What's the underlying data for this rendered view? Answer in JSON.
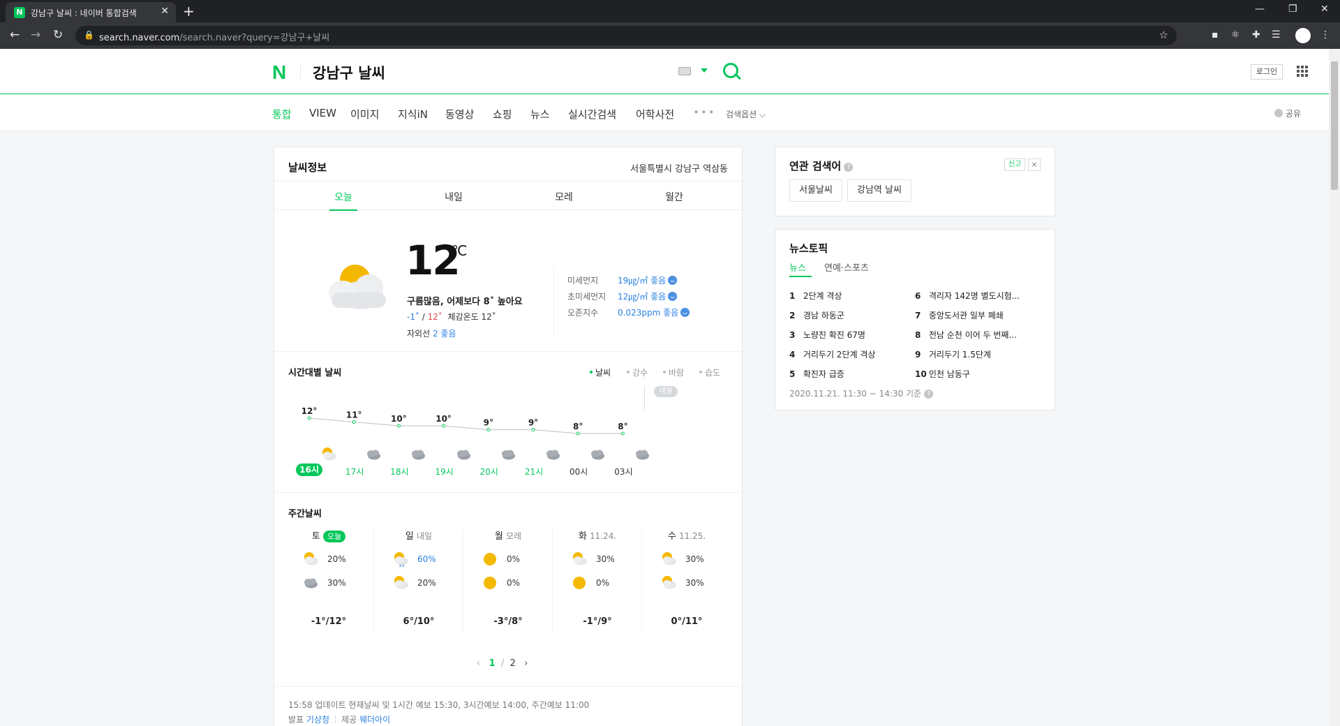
{
  "browser": {
    "tab_title": "강남구 날씨 : 네이버 통합검색",
    "tab_favicon": "N",
    "url_host": "search.naver.com",
    "url_path": "/search.naver?query=강남구+날씨"
  },
  "header": {
    "logo": "N",
    "query": "강남구 날씨",
    "login": "로그인"
  },
  "nav": {
    "items": [
      "통합",
      "VIEW",
      "이미지",
      "지식iN",
      "동영상",
      "쇼핑",
      "뉴스",
      "실시간검색",
      "어학사전"
    ],
    "more": "•••",
    "options": "검색옵션 ⌵",
    "share": "공유"
  },
  "weather": {
    "title": "날씨정보",
    "location": "서울특별시 강남구 역삼동",
    "tabs": [
      "오늘",
      "내일",
      "모레",
      "월간"
    ],
    "current": {
      "temp": "12",
      "unit": "℃",
      "summary": "구름많음, 어제보다 8˚ 높아요",
      "low": "-1˚",
      "high": "12˚",
      "feels": "체감온도 12˚",
      "uv_label": "자외선",
      "uv_value": "2 좋음"
    },
    "air": [
      {
        "label": "미세먼지",
        "value": "19㎍/㎥ 좋음"
      },
      {
        "label": "초미세먼지",
        "value": "12㎍/㎥ 좋음"
      },
      {
        "label": "오존지수",
        "value": "0.023ppm 좋음"
      }
    ],
    "hourly": {
      "title": "시간대별 날씨",
      "legend": [
        "날씨",
        "강수",
        "바람",
        "습도"
      ],
      "tomorrow_badge": "내일",
      "hours": [
        "16시",
        "17시",
        "18시",
        "19시",
        "20시",
        "21시",
        "00시",
        "03시"
      ],
      "temps": [
        12,
        11,
        10,
        10,
        9,
        9,
        8,
        8
      ],
      "temp_labels": [
        "12°",
        "11°",
        "10°",
        "10°",
        "9°",
        "9°",
        "8°",
        "8°"
      ],
      "icons": [
        "partly-cloudy",
        "cloudy",
        "cloudy",
        "cloudy",
        "cloudy",
        "cloudy",
        "cloudy",
        "cloudy"
      ]
    },
    "weekly": {
      "title": "주간날씨",
      "days": [
        {
          "day": "토",
          "sub": "오늘",
          "am_icon": "partly-cloudy",
          "am": "20%",
          "pm_icon": "cloudy",
          "pm": "30%",
          "temp": "-1°/12°"
        },
        {
          "day": "일",
          "sub": "내일",
          "am_icon": "rain-sun",
          "am": "60%",
          "pm_icon": "partly-cloudy",
          "pm": "20%",
          "temp": "6°/10°"
        },
        {
          "day": "월",
          "sub": "모레",
          "am_icon": "sunny",
          "am": "0%",
          "pm_icon": "sunny",
          "pm": "0%",
          "temp": "-3°/8°"
        },
        {
          "day": "화",
          "sub": "11.24.",
          "am_icon": "partly-cloudy",
          "am": "30%",
          "pm_icon": "sunny",
          "pm": "0%",
          "temp": "-1°/9°"
        },
        {
          "day": "수",
          "sub": "11.25.",
          "am_icon": "partly-cloudy",
          "am": "30%",
          "pm_icon": "partly-cloudy",
          "pm": "30%",
          "temp": "0°/11°"
        }
      ],
      "page_current": "1",
      "page_total": "2"
    },
    "update": "15:58 업데이트 현재날씨 및 1시간 예보 15:30, 3시간예보 14:00, 주간예보 11:00",
    "source_label1": "발표",
    "source_value1": "기상청",
    "source_label2": "제공",
    "source_value2": "웨더아이"
  },
  "related": {
    "title": "연관 검색어",
    "report": "신고",
    "close": "×",
    "keywords": [
      "서울날씨",
      "강남역 날씨"
    ]
  },
  "newstopic": {
    "title": "뉴스토픽",
    "tabs": [
      "뉴스",
      "연예·스포츠"
    ],
    "items": [
      {
        "n": "1",
        "t": "2단계 격상"
      },
      {
        "n": "2",
        "t": "경남 하동군"
      },
      {
        "n": "3",
        "t": "노량진 확진 67명"
      },
      {
        "n": "4",
        "t": "거리두기 2단계 격상"
      },
      {
        "n": "5",
        "t": "확진자 급증"
      },
      {
        "n": "6",
        "t": "격리자 142명 별도시험..."
      },
      {
        "n": "7",
        "t": "중앙도서관 일부 폐쇄"
      },
      {
        "n": "8",
        "t": "전남 순천 이어 두 번째..."
      },
      {
        "n": "9",
        "t": "거리두기 1.5단계"
      },
      {
        "n": "10",
        "t": "인천 남동구"
      }
    ],
    "footer": "2020.11.21. 11:30 ~ 14:30 기준"
  }
}
